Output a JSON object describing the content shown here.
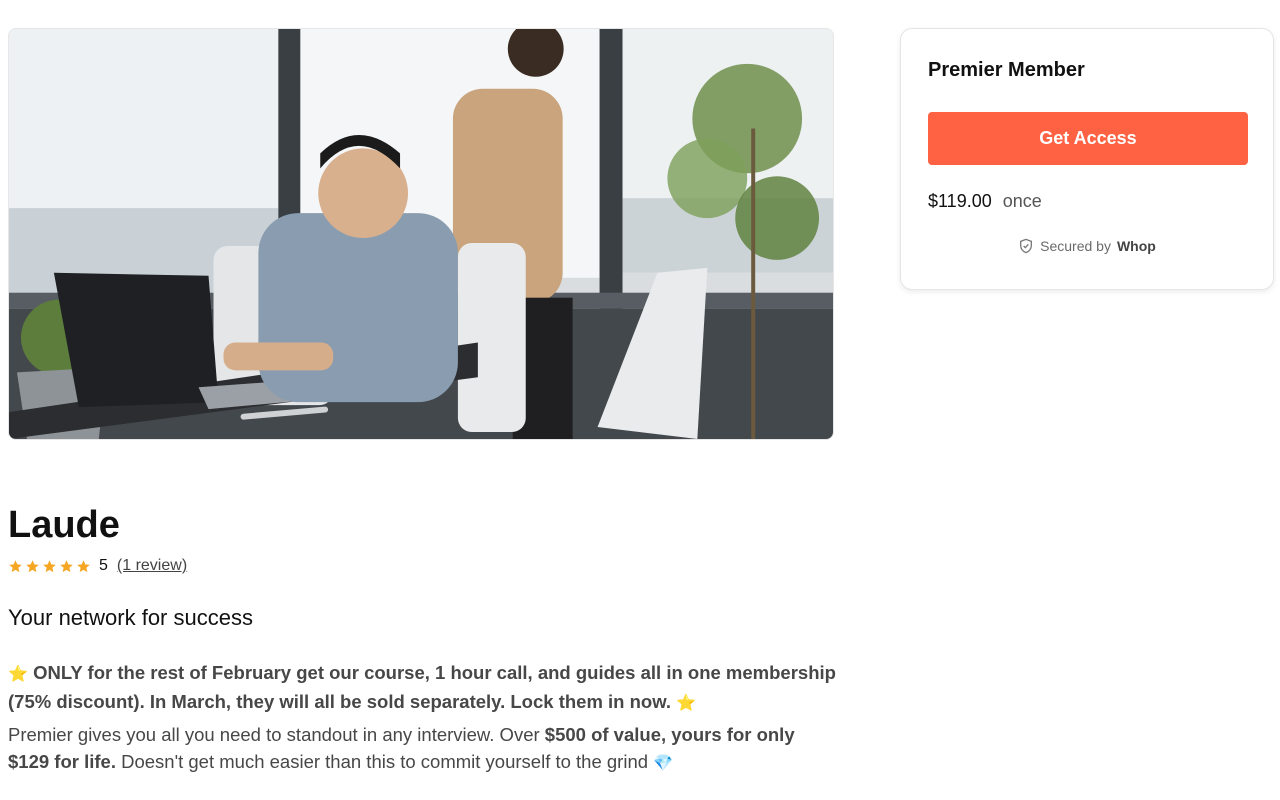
{
  "hero": {
    "alt": "Office workers at a desk with laptop by a window"
  },
  "card": {
    "title": "Premier Member",
    "cta_label": "Get Access",
    "price": "$119.00",
    "cadence": "once",
    "secured_prefix": "Secured by",
    "secured_brand": "Whop"
  },
  "product": {
    "name": "Laude",
    "rating_value": "5",
    "rating_stars": 5,
    "reviews_link": "(1 review)",
    "tagline": "Your network for success"
  },
  "promo": {
    "star_left": "⭐",
    "text": "ONLY for the rest of February get our course, 1 hour call, and guides all in one membership (75% discount). In March, they will all be sold separately. Lock them in now.",
    "star_right": "⭐"
  },
  "description": {
    "part1": "Premier gives you all you need to standout in any interview. Over ",
    "bold": "$500 of value, yours for only $129 for life.",
    "part2": " Doesn't get much easier than this to commit yourself to the grind ",
    "emoji": "💎"
  },
  "colors": {
    "accent": "#ff6243",
    "star": "#f5a623"
  }
}
